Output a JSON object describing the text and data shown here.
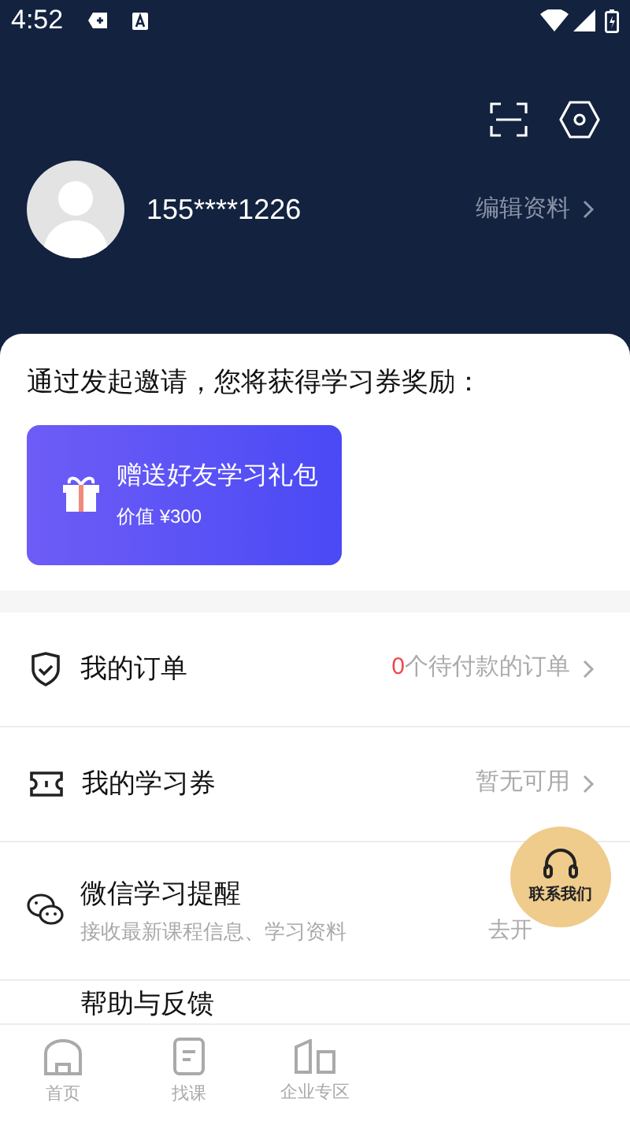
{
  "status_bar": {
    "time": "4:52"
  },
  "profile": {
    "phone": "155****1226",
    "edit_link": "编辑资料"
  },
  "invite": {
    "title": "通过发起邀请，您将获得学习券奖励：",
    "card_title": "赠送好友学习礼包",
    "card_value": "价值 ¥300"
  },
  "menu": [
    {
      "kind": "order",
      "label": "我的订单",
      "count": "0",
      "detail": "个待付款的订单"
    },
    {
      "kind": "voucher",
      "label": "我的学习券",
      "detail": "暂无可用"
    },
    {
      "kind": "wechat",
      "label": "微信学习提醒",
      "subtitle": "接收最新课程信息、学习资料",
      "detail": "去开"
    },
    {
      "kind": "help",
      "label": "帮助与反馈"
    }
  ],
  "contact_button": {
    "label": "联系我们"
  },
  "bottom_nav": [
    {
      "kind": "home",
      "label": "首页",
      "selected": false
    },
    {
      "kind": "course",
      "label": "找课",
      "selected": false
    },
    {
      "kind": "enterprise",
      "label": "企业专区",
      "selected": false
    }
  ]
}
